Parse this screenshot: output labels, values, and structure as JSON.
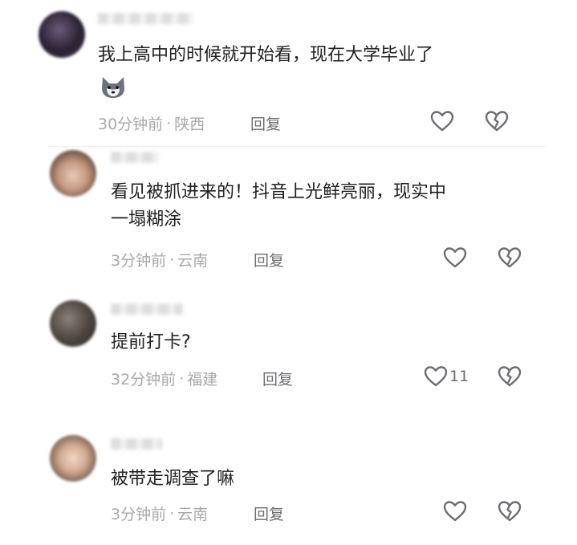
{
  "comments": [
    {
      "text": "我上高中的时候就开始看，现在大学毕业了",
      "has_emoji": true,
      "time": "30分钟前",
      "location": "陕西",
      "reply_label": "回复",
      "like_count": ""
    },
    {
      "text": "看见被抓进来的！抖音上光鲜亮丽，现实中\n一塌糊涂",
      "has_emoji": false,
      "time": "3分钟前",
      "location": "云南",
      "reply_label": "回复",
      "like_count": ""
    },
    {
      "text": "提前打卡?",
      "has_emoji": false,
      "time": "32分钟前",
      "location": "福建",
      "reply_label": "回复",
      "like_count": "11"
    },
    {
      "text": "被带走调查了嘛",
      "has_emoji": false,
      "time": "3分钟前",
      "location": "云南",
      "reply_label": "回复",
      "like_count": ""
    }
  ],
  "meta_separator": "·",
  "colors": {
    "text": "#1f1f1f",
    "meta": "#a9a9ad",
    "reply": "#6d6e73",
    "icon": "#6d6e73"
  },
  "icons": {
    "like": "heart-outline-icon",
    "dislike": "broken-heart-icon",
    "emoji": "wolf-face-emoji-icon"
  }
}
